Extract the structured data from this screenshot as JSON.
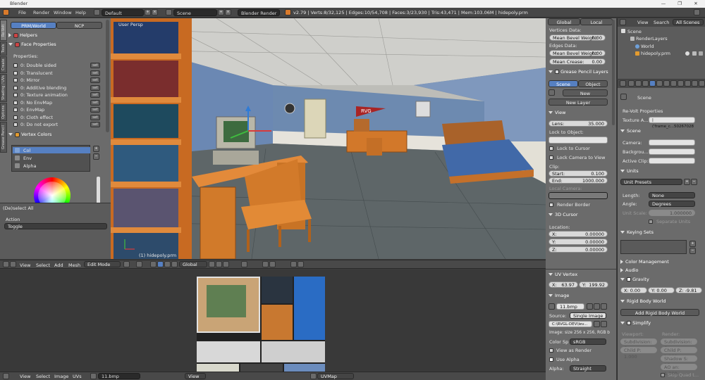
{
  "window": {
    "title": "Blender"
  },
  "menubar": {
    "items": [
      "File",
      "Render",
      "Window",
      "Help"
    ],
    "layout": "Default",
    "scene": "Scene",
    "engine": "Blender Render",
    "stats": "v2.79 | Verts:8/32,125 | Edges:10/54,708 | Faces:3/23,930 | Tris:43,471 | Mem:103.06M | hidepoly.prm"
  },
  "left_panel": {
    "vtabs": [
      "Re-Volt",
      "Tools",
      "Create",
      "Shading / UVs",
      "Options",
      "Grease Pencil"
    ],
    "tabs": [
      "PRM/World",
      "NCP"
    ],
    "helpers": "Helpers",
    "face_props": "Face Properties",
    "properties_label": "Properties:",
    "properties": [
      "0: Double sided",
      "0: Translucent",
      "0: Mirror",
      "0: Additive blending",
      "0: Texture animation",
      "0: No EnvMap",
      "0: EnvMap",
      "0: Cloth effect",
      "0: Do not export"
    ],
    "set_label": "set",
    "vertex_colors": "Vertex Colors",
    "vc_items": [
      "Col",
      "Env",
      "Alpha"
    ],
    "deselect_all": "(De)select All",
    "action_label": "Action",
    "action_value": "Toggle"
  },
  "viewport": {
    "label": "User Persp",
    "object_label": "(1) hidepoly.prm",
    "banner": "RVG",
    "header": {
      "menus": [
        "View",
        "Select",
        "Add",
        "Mesh"
      ],
      "mode": "Edit Mode",
      "orientation": "Global"
    }
  },
  "n_panel": {
    "tabs": [
      "Global",
      "Local"
    ],
    "vertices_data": "Vertices Data:",
    "mean_bevel_weight": "Mean Bevel Weight:",
    "mbw_v_value": "0.00",
    "edges_data": "Edges Data:",
    "mbw_e_value": "0.00",
    "mean_crease": "Mean Crease:",
    "mean_crease_value": "0.00",
    "grease_pencil": "Grease Pencil Layers",
    "gp_tabs": [
      "Scene",
      "Object"
    ],
    "new": "New",
    "new_layer": "New Layer",
    "view": "View",
    "lens": "Lens:",
    "lens_value": "35.000",
    "lock_to_object": "Lock to Object:",
    "lock_to_cursor": "Lock to Cursor",
    "lock_camera": "Lock Camera to View",
    "clip": "Clip:",
    "clip_start": "Start:",
    "clip_start_value": "0.100",
    "clip_end": "End:",
    "clip_end_value": "1000.000",
    "local_camera": "Local Camera:",
    "render_border": "Render Border",
    "cursor_3d": "3D Cursor",
    "location": "Location:",
    "loc_x": "X:",
    "loc_y": "Y:",
    "loc_z": "Z:",
    "loc_value": "0.00000"
  },
  "uv_editor": {
    "header": {
      "menus": [
        "View",
        "Select",
        "Image",
        "UVs"
      ],
      "image": "11.bmp",
      "view": "View",
      "uvmap": "UVMap"
    },
    "side": {
      "uv_vertex": "UV Vertex",
      "x_label": "X:",
      "x_value": "63.97",
      "y_label": "Y:",
      "y_value": "199.92",
      "image": "Image",
      "image_name": "11.bmp",
      "source_label": "Source:",
      "source_value": "Single Image",
      "path": "C:\\RVGL-DEV\\lev...",
      "image_info": "Image: size 256 x 256, RGB b",
      "color_space_label": "Color Sp",
      "color_space": "sRGB",
      "view_as_render": "View as Render",
      "use_alpha": "Use Alpha",
      "alpha_label": "Alpha:",
      "alpha_value": "Straight"
    }
  },
  "outliner": {
    "header": [
      "View",
      "Search",
      "All Scenes"
    ],
    "items": [
      "Scene",
      "RenderLayers",
      "World",
      "hidepoly.prm"
    ]
  },
  "properties": {
    "breadcrumb": "Scene",
    "revolt_props": "Re-Volt Properties",
    "texture_label": "Texture A...",
    "texture_value": "| ('frame_c...50267028",
    "scene": "Scene",
    "camera": "Camera:",
    "background": "Backgrou...",
    "active_clip": "Active Clip:",
    "units": "Units",
    "unit_presets": "Unit Presets",
    "length_label": "Length:",
    "length_value": "None",
    "angle_label": "Angle:",
    "angle_value": "Degrees",
    "unit_scale_label": "Unit Scale:",
    "unit_scale_value": "1.000000",
    "separate_units": "Separate Units",
    "keying_sets": "Keying Sets",
    "color_management": "Color Management",
    "audio": "Audio",
    "gravity": "Gravity",
    "grav_x": "X: 0.00",
    "grav_y": "Y: 0.00",
    "grav_z": "Z: -9.81",
    "rigid_body_world": "Rigid Body World",
    "add_rbw": "Add Rigid Body World",
    "simplify": "Simplify",
    "viewport_label": "Viewport:",
    "render_label": "Render:",
    "subdivision": "Subdivision: 6",
    "child_p": "Child P: 1.000",
    "shadow": "Shadow S: 16",
    "ao": "AO an: 1.000",
    "skip_quad": "Skip Quad t..."
  }
}
